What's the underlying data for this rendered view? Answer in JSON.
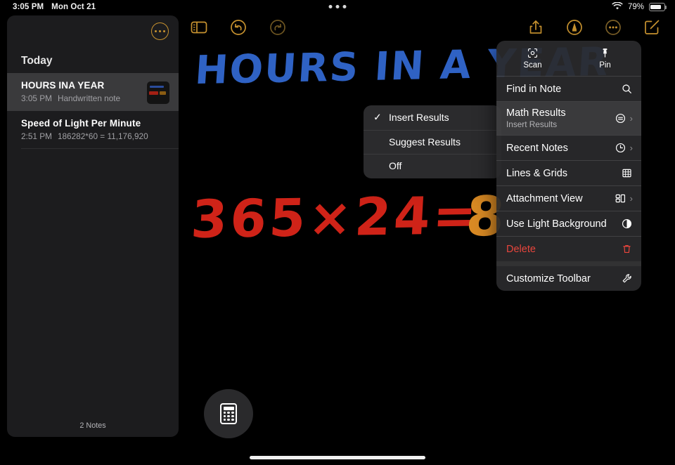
{
  "status_bar": {
    "time": "3:05 PM",
    "date": "Mon Oct 21",
    "battery_percent": "79%",
    "wifi_icon": "wifi-icon",
    "battery_icon": "battery-icon",
    "multitask_handle": "multitask-dots"
  },
  "sidebar": {
    "more_button_icon": "ellipsis-circle-icon",
    "section_title": "Today",
    "notes": [
      {
        "title": "HOURS INA YEAR",
        "time": "3:05 PM",
        "preview": "Handwritten note",
        "selected": true
      },
      {
        "title": "Speed of Light Per Minute",
        "time": "2:51 PM",
        "preview": "186282*60 = 11,176,920",
        "selected": false
      }
    ],
    "footer": "2 Notes"
  },
  "toolbar": {
    "left": [
      {
        "name": "sidebar-toggle-icon",
        "label": "Sidebar"
      },
      {
        "name": "undo-icon",
        "label": "Undo"
      },
      {
        "name": "redo-icon",
        "label": "Redo"
      }
    ],
    "right": [
      {
        "name": "share-icon",
        "label": "Share"
      },
      {
        "name": "markup-pen-icon",
        "label": "Markup"
      },
      {
        "name": "more-ellipsis-icon",
        "label": "More"
      },
      {
        "name": "compose-icon",
        "label": "New Note"
      }
    ]
  },
  "canvas": {
    "handwritten_title": "HOURS IN A YEAR",
    "handwritten_equation": "365×24=",
    "handwritten_result": "8",
    "calculator_button_icon": "calculator-icon"
  },
  "submenu": {
    "items": [
      {
        "label": "Insert Results",
        "checked": true
      },
      {
        "label": "Suggest Results",
        "checked": false
      },
      {
        "label": "Off",
        "checked": false
      }
    ]
  },
  "context_menu": {
    "header": [
      {
        "label": "Scan",
        "icon": "scan-document-icon"
      },
      {
        "label": "Pin",
        "icon": "pin-icon"
      }
    ],
    "items": [
      {
        "label": "Find in Note",
        "sublabel": "",
        "icon": "magnifier-icon",
        "chevron": false,
        "highlighted": false,
        "danger": false
      },
      {
        "label": "Math Results",
        "sublabel": "Insert Results",
        "icon": "equals-circle-icon",
        "chevron": true,
        "highlighted": true,
        "danger": false
      },
      {
        "label": "Recent Notes",
        "sublabel": "",
        "icon": "clock-icon",
        "chevron": true,
        "highlighted": false,
        "danger": false
      },
      {
        "label": "Lines & Grids",
        "sublabel": "",
        "icon": "grid-icon",
        "chevron": false,
        "highlighted": false,
        "danger": false
      },
      {
        "label": "Attachment View",
        "sublabel": "",
        "icon": "attachment-view-icon",
        "chevron": true,
        "highlighted": false,
        "danger": false
      },
      {
        "label": "Use Light Background",
        "sublabel": "",
        "icon": "contrast-circle-icon",
        "chevron": false,
        "highlighted": false,
        "danger": false
      },
      {
        "label": "Delete",
        "sublabel": "",
        "icon": "trash-icon",
        "chevron": false,
        "highlighted": false,
        "danger": true
      },
      {
        "label": "Customize Toolbar",
        "sublabel": "",
        "icon": "wrench-icon",
        "chevron": false,
        "highlighted": false,
        "danger": false
      }
    ]
  },
  "colors": {
    "accent": "#c7922f",
    "ink_blue": "#2f62c4",
    "ink_red": "#cf2318",
    "ink_orange": "#d98a24",
    "delete_red": "#e8453c"
  }
}
